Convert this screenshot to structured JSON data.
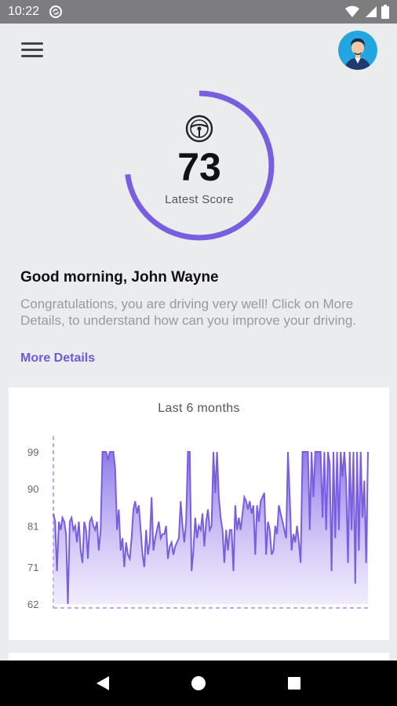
{
  "status_bar": {
    "time": "10:22"
  },
  "header": {
    "menu_icon": "hamburger-menu-icon",
    "avatar_icon": "user-avatar-icon"
  },
  "score": {
    "value": "73",
    "label": "Latest Score",
    "fraction": 0.73,
    "icon": "steering-wheel-icon",
    "accent_color": "#7a5ee0"
  },
  "greeting": {
    "title": "Good morning, John Wayne",
    "message": "Congratulations, you are driving very well! Click on More Details, to understand how can you improve your driving.",
    "link": "More Details"
  },
  "chart_data": {
    "type": "area",
    "title": "Last 6 months",
    "yticks": [
      "99",
      "90",
      "81",
      "71",
      "62"
    ],
    "ylim": [
      62,
      99
    ],
    "grid": false,
    "color": "#7a5ee0",
    "values": [
      84,
      82,
      70,
      82,
      80,
      83,
      82,
      79,
      62,
      82,
      83,
      80,
      81,
      77,
      82,
      75,
      72,
      82,
      80,
      73,
      82,
      83,
      81,
      80,
      82,
      75,
      80,
      99,
      99,
      99,
      97,
      99,
      99,
      99,
      95,
      80,
      85,
      75,
      78,
      71,
      77,
      74,
      73,
      78,
      85,
      87,
      84,
      86,
      80,
      74,
      71,
      80,
      74,
      77,
      88,
      75,
      78,
      80,
      82,
      78,
      79,
      79,
      81,
      73,
      76,
      77,
      74,
      76,
      77,
      78,
      87,
      81,
      77,
      82,
      99,
      99,
      70,
      75,
      83,
      78,
      81,
      80,
      84,
      76,
      82,
      85,
      80,
      81,
      99,
      89,
      99,
      88,
      83,
      80,
      72,
      80,
      75,
      80,
      80,
      70,
      86,
      80,
      83,
      80,
      84,
      88,
      87,
      85,
      87,
      84,
      86,
      74,
      86,
      82,
      87,
      88,
      89,
      74,
      82,
      80,
      74,
      75,
      81,
      79,
      86,
      84,
      82,
      80,
      78,
      99,
      88,
      75,
      79,
      77,
      81,
      77,
      72,
      99,
      99,
      99,
      99,
      80,
      99,
      88,
      99,
      99,
      99,
      99,
      83,
      99,
      80,
      99,
      96,
      70,
      99,
      78,
      99,
      80,
      99,
      93,
      99,
      92,
      72,
      99,
      80,
      99,
      67,
      99,
      75,
      99,
      83,
      92,
      72,
      99
    ]
  },
  "nav": {
    "back_icon": "back-triangle-icon",
    "home_icon": "home-circle-icon",
    "recents_icon": "recents-square-icon"
  }
}
